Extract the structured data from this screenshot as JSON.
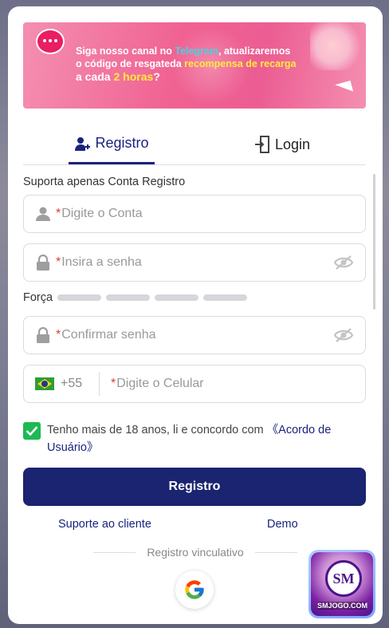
{
  "banner": {
    "line1_pre": "Siga nosso canal no ",
    "line1_hl": "Telegram",
    "line1_post": ", atualizaremos",
    "line2_pre": "o código de resgateda ",
    "line2_hl": "recompensa de recarga",
    "line3_pre": "a cada ",
    "line3_hl": "2 horas",
    "line3_post": "?"
  },
  "tabs": {
    "register": "Registro",
    "login": "Login"
  },
  "form": {
    "top_label": "Suporta apenas Conta Registro",
    "account_placeholder": "Digite o Conta",
    "password_placeholder": "Insira a senha",
    "strength_label": "Força",
    "confirm_placeholder": "Confirmar senha",
    "phone_code": "+55",
    "phone_placeholder": "Digite o Celular",
    "required_mark": "*"
  },
  "agreement": {
    "text": "Tenho mais de 18 anos, li e concordo com ",
    "link": "《Acordo de Usuário》",
    "checked": true
  },
  "buttons": {
    "submit": "Registro"
  },
  "links": {
    "support": "Suporte ao cliente",
    "demo": "Demo"
  },
  "social": {
    "divider_label": "Registro vinculativo",
    "provider_icon": "google-icon"
  },
  "badge": {
    "logo": "SM",
    "caption": "SMJOGO.COM"
  },
  "colors": {
    "primary": "#1b2470",
    "checkbox": "#1db954",
    "required": "#e53935"
  }
}
